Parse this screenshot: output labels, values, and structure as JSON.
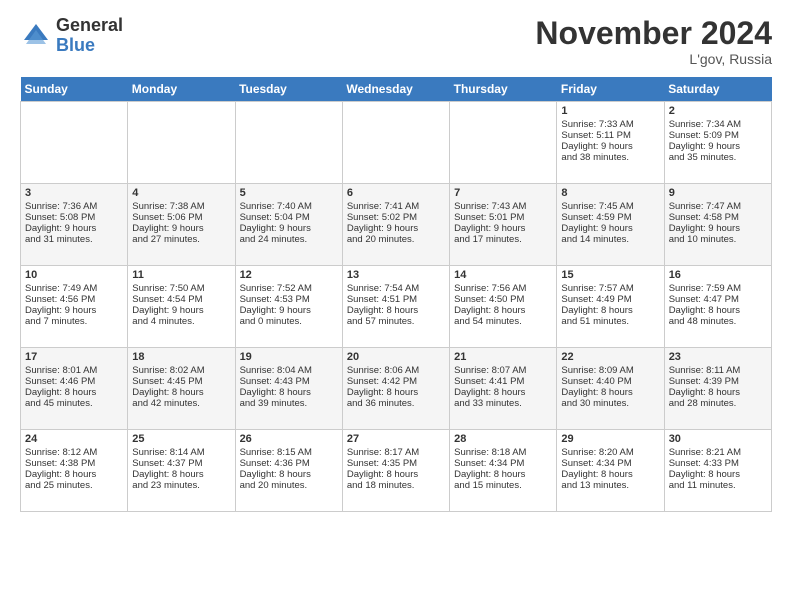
{
  "logo": {
    "general": "General",
    "blue": "Blue"
  },
  "title": "November 2024",
  "location": "L'gov, Russia",
  "days_header": [
    "Sunday",
    "Monday",
    "Tuesday",
    "Wednesday",
    "Thursday",
    "Friday",
    "Saturday"
  ],
  "weeks": [
    [
      {
        "day": "",
        "info": ""
      },
      {
        "day": "",
        "info": ""
      },
      {
        "day": "",
        "info": ""
      },
      {
        "day": "",
        "info": ""
      },
      {
        "day": "",
        "info": ""
      },
      {
        "day": "1",
        "info": "Sunrise: 7:33 AM\nSunset: 5:11 PM\nDaylight: 9 hours\nand 38 minutes."
      },
      {
        "day": "2",
        "info": "Sunrise: 7:34 AM\nSunset: 5:09 PM\nDaylight: 9 hours\nand 35 minutes."
      }
    ],
    [
      {
        "day": "3",
        "info": "Sunrise: 7:36 AM\nSunset: 5:08 PM\nDaylight: 9 hours\nand 31 minutes."
      },
      {
        "day": "4",
        "info": "Sunrise: 7:38 AM\nSunset: 5:06 PM\nDaylight: 9 hours\nand 27 minutes."
      },
      {
        "day": "5",
        "info": "Sunrise: 7:40 AM\nSunset: 5:04 PM\nDaylight: 9 hours\nand 24 minutes."
      },
      {
        "day": "6",
        "info": "Sunrise: 7:41 AM\nSunset: 5:02 PM\nDaylight: 9 hours\nand 20 minutes."
      },
      {
        "day": "7",
        "info": "Sunrise: 7:43 AM\nSunset: 5:01 PM\nDaylight: 9 hours\nand 17 minutes."
      },
      {
        "day": "8",
        "info": "Sunrise: 7:45 AM\nSunset: 4:59 PM\nDaylight: 9 hours\nand 14 minutes."
      },
      {
        "day": "9",
        "info": "Sunrise: 7:47 AM\nSunset: 4:58 PM\nDaylight: 9 hours\nand 10 minutes."
      }
    ],
    [
      {
        "day": "10",
        "info": "Sunrise: 7:49 AM\nSunset: 4:56 PM\nDaylight: 9 hours\nand 7 minutes."
      },
      {
        "day": "11",
        "info": "Sunrise: 7:50 AM\nSunset: 4:54 PM\nDaylight: 9 hours\nand 4 minutes."
      },
      {
        "day": "12",
        "info": "Sunrise: 7:52 AM\nSunset: 4:53 PM\nDaylight: 9 hours\nand 0 minutes."
      },
      {
        "day": "13",
        "info": "Sunrise: 7:54 AM\nSunset: 4:51 PM\nDaylight: 8 hours\nand 57 minutes."
      },
      {
        "day": "14",
        "info": "Sunrise: 7:56 AM\nSunset: 4:50 PM\nDaylight: 8 hours\nand 54 minutes."
      },
      {
        "day": "15",
        "info": "Sunrise: 7:57 AM\nSunset: 4:49 PM\nDaylight: 8 hours\nand 51 minutes."
      },
      {
        "day": "16",
        "info": "Sunrise: 7:59 AM\nSunset: 4:47 PM\nDaylight: 8 hours\nand 48 minutes."
      }
    ],
    [
      {
        "day": "17",
        "info": "Sunrise: 8:01 AM\nSunset: 4:46 PM\nDaylight: 8 hours\nand 45 minutes."
      },
      {
        "day": "18",
        "info": "Sunrise: 8:02 AM\nSunset: 4:45 PM\nDaylight: 8 hours\nand 42 minutes."
      },
      {
        "day": "19",
        "info": "Sunrise: 8:04 AM\nSunset: 4:43 PM\nDaylight: 8 hours\nand 39 minutes."
      },
      {
        "day": "20",
        "info": "Sunrise: 8:06 AM\nSunset: 4:42 PM\nDaylight: 8 hours\nand 36 minutes."
      },
      {
        "day": "21",
        "info": "Sunrise: 8:07 AM\nSunset: 4:41 PM\nDaylight: 8 hours\nand 33 minutes."
      },
      {
        "day": "22",
        "info": "Sunrise: 8:09 AM\nSunset: 4:40 PM\nDaylight: 8 hours\nand 30 minutes."
      },
      {
        "day": "23",
        "info": "Sunrise: 8:11 AM\nSunset: 4:39 PM\nDaylight: 8 hours\nand 28 minutes."
      }
    ],
    [
      {
        "day": "24",
        "info": "Sunrise: 8:12 AM\nSunset: 4:38 PM\nDaylight: 8 hours\nand 25 minutes."
      },
      {
        "day": "25",
        "info": "Sunrise: 8:14 AM\nSunset: 4:37 PM\nDaylight: 8 hours\nand 23 minutes."
      },
      {
        "day": "26",
        "info": "Sunrise: 8:15 AM\nSunset: 4:36 PM\nDaylight: 8 hours\nand 20 minutes."
      },
      {
        "day": "27",
        "info": "Sunrise: 8:17 AM\nSunset: 4:35 PM\nDaylight: 8 hours\nand 18 minutes."
      },
      {
        "day": "28",
        "info": "Sunrise: 8:18 AM\nSunset: 4:34 PM\nDaylight: 8 hours\nand 15 minutes."
      },
      {
        "day": "29",
        "info": "Sunrise: 8:20 AM\nSunset: 4:34 PM\nDaylight: 8 hours\nand 13 minutes."
      },
      {
        "day": "30",
        "info": "Sunrise: 8:21 AM\nSunset: 4:33 PM\nDaylight: 8 hours\nand 11 minutes."
      }
    ]
  ]
}
